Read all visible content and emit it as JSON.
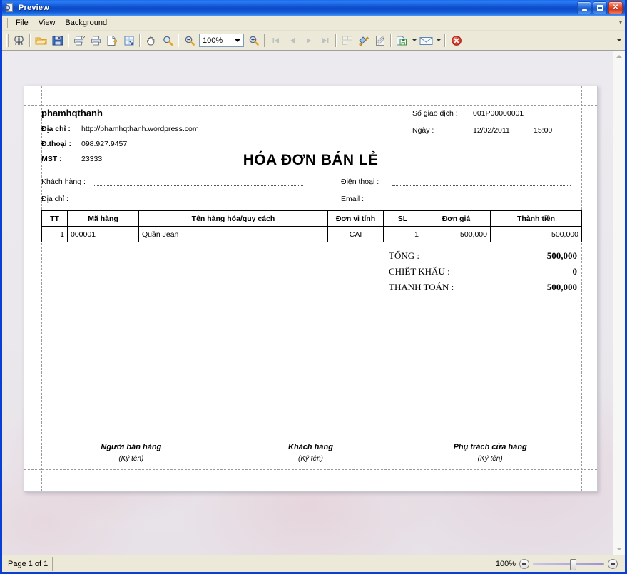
{
  "window": {
    "title": "Preview",
    "icon": "preview-magnifier-icon",
    "buttons": {
      "minimize": "_",
      "maximize": "□",
      "close": "✕"
    }
  },
  "menubar": {
    "items": [
      {
        "label": "File",
        "accel": "F"
      },
      {
        "label": "View",
        "accel": "V"
      },
      {
        "label": "Background",
        "accel": "B"
      }
    ],
    "overflow": "▾"
  },
  "toolbar": {
    "zoom_value": "100%",
    "buttons": [
      {
        "name": "find-icon",
        "tip": "Find"
      },
      {
        "name": "open-icon",
        "tip": "Open"
      },
      {
        "name": "save-icon",
        "tip": "Save"
      },
      {
        "name": "print-setup-icon",
        "tip": "Print Setup"
      },
      {
        "name": "print-icon",
        "tip": "Print"
      },
      {
        "name": "page-setup-icon",
        "tip": "Page Setup"
      },
      {
        "name": "scale-icon",
        "tip": "Scale"
      },
      {
        "name": "hand-tool-icon",
        "tip": "Hand Tool"
      },
      {
        "name": "magnifier-tool-icon",
        "tip": "Magnifier"
      },
      {
        "name": "zoom-out-icon",
        "tip": "Zoom Out"
      },
      {
        "name": "zoom-in-icon",
        "tip": "Zoom In"
      },
      {
        "name": "first-page-icon",
        "tip": "First Page"
      },
      {
        "name": "previous-page-icon",
        "tip": "Previous Page"
      },
      {
        "name": "next-page-icon",
        "tip": "Next Page"
      },
      {
        "name": "last-page-icon",
        "tip": "Last Page"
      },
      {
        "name": "multiple-pages-icon",
        "tip": "Multiple Pages"
      },
      {
        "name": "page-color-icon",
        "tip": "Page Color"
      },
      {
        "name": "watermark-icon",
        "tip": "Watermark"
      },
      {
        "name": "export-icon",
        "tip": "Export"
      },
      {
        "name": "email-icon",
        "tip": "Send via E-Mail"
      },
      {
        "name": "close-preview-icon",
        "tip": "Close Preview"
      }
    ]
  },
  "document": {
    "company_name": "phamhqthanh",
    "fields": [
      {
        "label": "Địa chỉ :",
        "value": "http://phamhqthanh.wordpress.com"
      },
      {
        "label": "Đ.thoại :",
        "value": "098.927.9457"
      },
      {
        "label": "MST :",
        "value": "23333"
      }
    ],
    "meta": [
      {
        "label": "Số giao dịch :",
        "value": "001P00000001"
      },
      {
        "label": "Ngày :",
        "value": "12/02/2011",
        "value2": "15:00"
      }
    ],
    "title": "HÓA ĐƠN BÁN LẺ",
    "customer_fields": [
      {
        "label": "Khách hàng :",
        "value": ""
      },
      {
        "label": "Điện thoại :",
        "value": ""
      },
      {
        "label": "Địa chỉ  :",
        "value": ""
      },
      {
        "label": "Email :",
        "value": ""
      }
    ],
    "table": {
      "headers": [
        "TT",
        "Mã hàng",
        "Tên hàng hóa/quy cách",
        "Đơn vị tính",
        "SL",
        "Đơn giá",
        "Thành tiền"
      ],
      "rows": [
        {
          "tt": "1",
          "ma_hang": "000001",
          "ten_hang": "Quần Jean",
          "don_vi_tinh": "CAI",
          "sl": "1",
          "don_gia": "500,000",
          "thanh_tien": "500,000"
        }
      ]
    },
    "totals": [
      {
        "label": "TỔNG :",
        "value": "500,000"
      },
      {
        "label": "CHIẾT KHẤU :",
        "value": "0"
      },
      {
        "label": "THANH TOÁN :",
        "value": "500,000"
      }
    ],
    "signatures": [
      {
        "role": "Người bán hàng",
        "sub": "(Ký tên)"
      },
      {
        "role": "Khách hàng",
        "sub": "(Ký tên)"
      },
      {
        "role": "Phụ trách cửa hàng",
        "sub": "(Ký tên)"
      }
    ]
  },
  "statusbar": {
    "page_info": "Page 1 of 1",
    "zoom_percent": "100%",
    "zoom_out": "−",
    "zoom_in": "+"
  },
  "colors": {
    "titlebar_blue": "#0c4ac9",
    "window_border": "#0a3fd4",
    "chrome": "#ece9d8",
    "page_white": "#ffffff"
  }
}
